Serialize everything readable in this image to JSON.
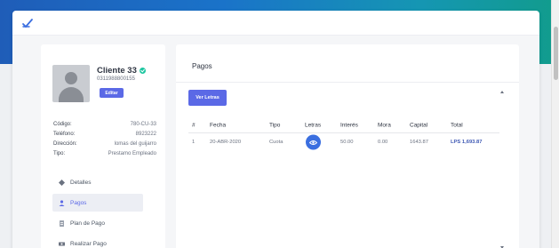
{
  "profile": {
    "name": "Cliente 33",
    "id_number": "0311988800155",
    "edit_label": "Editar",
    "details": [
      {
        "label": "Código:",
        "value": "780-CU-33"
      },
      {
        "label": "Teléfono:",
        "value": "8923222"
      },
      {
        "label": "Dirección:",
        "value": "lomas del guijarro"
      },
      {
        "label": "Tipo:",
        "value": "Prestamo Empleado"
      }
    ]
  },
  "menu": [
    {
      "label": "Detalles",
      "icon": "diamond-icon"
    },
    {
      "label": "Pagos",
      "icon": "user-icon",
      "active": true
    },
    {
      "label": "Plan de Pago",
      "icon": "document-icon"
    },
    {
      "label": "Realizar Pago",
      "icon": "money-icon"
    }
  ],
  "payments": {
    "title": "Pagos",
    "ver_letras_label": "Ver Letras",
    "columns": [
      "#",
      "Fecha",
      "Tipo",
      "Letras",
      "Interés",
      "Mora",
      "Capital",
      "Total"
    ],
    "rows": [
      {
        "num": "1",
        "fecha": "20-ABR-2020",
        "tipo": "Cuota",
        "interes": "50.00",
        "mora": "0.00",
        "capital": "1643.87",
        "total": "LPS 1,693.87"
      }
    ]
  },
  "colors": {
    "accent": "#5b69e6",
    "header_gradient_start": "#1f5db8",
    "header_gradient_end": "#119c8c",
    "eye_button": "#3b6fe0",
    "total_text": "#3f59b4"
  }
}
